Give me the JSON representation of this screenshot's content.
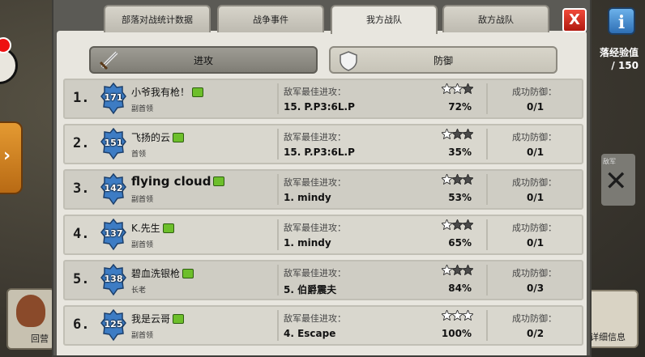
{
  "tabs": [
    {
      "label": "部落对战统计数据",
      "active": false
    },
    {
      "label": "战争事件",
      "active": false
    },
    {
      "label": "我方战队",
      "active": true
    },
    {
      "label": "敌方战队",
      "active": false
    }
  ],
  "close_label": "X",
  "info_label": "i",
  "subtabs": {
    "attack_label": "进攻",
    "defense_label": "防御",
    "selected": "defense"
  },
  "background": {
    "right_top_label": "落经验值",
    "right_top_value": "/ 150",
    "right_mid_label": "敌军",
    "left_card_label": "回营",
    "right_card_label": "详细信息"
  },
  "columns": {
    "best_attack_label": "敌军最佳进攻：",
    "defense_label": "成功防御："
  },
  "members": [
    {
      "rank": "1.",
      "level": "171",
      "name": "小爷我有枪！",
      "role": "副首领",
      "target": "15. P.P3:6L.P",
      "stars": 2,
      "percent": "72%",
      "defenses": "0/1",
      "name_big": false
    },
    {
      "rank": "2.",
      "level": "151",
      "name": "飞扬的云",
      "role": "首领",
      "target": "15. P.P3:6L.P",
      "stars": 1,
      "percent": "35%",
      "defenses": "0/1",
      "name_big": false
    },
    {
      "rank": "3.",
      "level": "142",
      "name": "flying cloud",
      "role": "副首领",
      "target": "1. mindy",
      "stars": 1,
      "percent": "53%",
      "defenses": "0/1",
      "name_big": true
    },
    {
      "rank": "4.",
      "level": "137",
      "name": "K.先生",
      "role": "副首领",
      "target": "1. mindy",
      "stars": 1,
      "percent": "65%",
      "defenses": "0/1",
      "name_big": false
    },
    {
      "rank": "5.",
      "level": "138",
      "name": "碧血洗银枪",
      "role": "长老",
      "target": "5. 伯爵震夫",
      "stars": 1,
      "percent": "84%",
      "defenses": "0/3",
      "name_big": false
    },
    {
      "rank": "6.",
      "level": "125",
      "name": "我是云哥",
      "role": "副首领",
      "target": "4. Escape",
      "stars": 3,
      "percent": "100%",
      "defenses": "0/2",
      "name_big": false
    }
  ],
  "colors": {
    "level_badge": "#3d7cc4",
    "star_on": "#ffffff",
    "star_off": "#4a4a4a",
    "close": "#d8281c",
    "info": "#3f86cf"
  }
}
